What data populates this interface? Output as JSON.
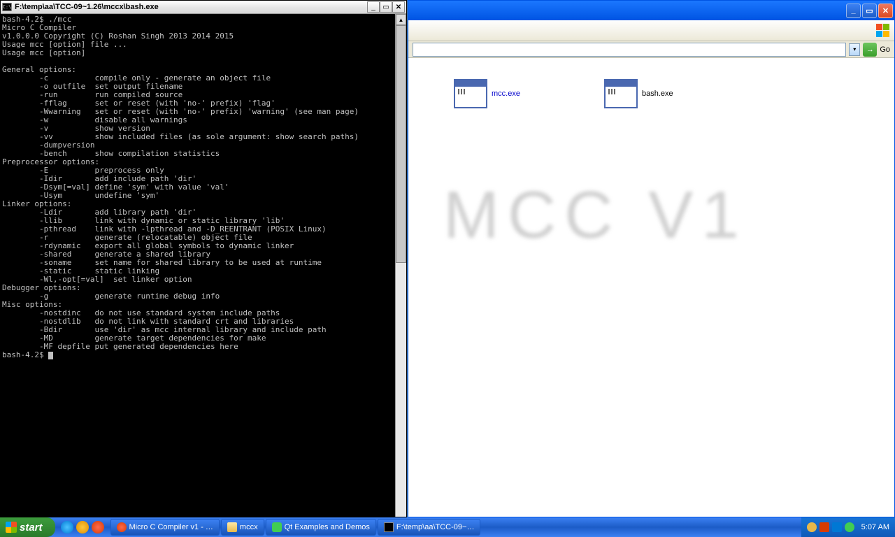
{
  "terminal": {
    "title": "F:\\temp\\aa\\TCC-09~1.26\\mccx\\bash.exe",
    "lines": [
      "bash-4.2$ ./mcc",
      "Micro C Compiler",
      "v1.0.0.0 Copyright (C) Roshan Singh 2013 2014 2015",
      "Usage mcc [option] file ...",
      "Usage mcc [option]",
      "",
      "General options:",
      "        -c          compile only - generate an object file",
      "        -o outfile  set output filename",
      "        -run        run compiled source",
      "        -fflag      set or reset (with 'no-' prefix) 'flag'",
      "        -Wwarning   set or reset (with 'no-' prefix) 'warning' (see man page)",
      "        -w          disable all warnings",
      "        -v          show version",
      "        -vv         show included files (as sole argument: show search paths)",
      "        -dumpversion",
      "        -bench      show compilation statistics",
      "Preprocessor options:",
      "        -E          preprocess only",
      "        -Idir       add include path 'dir'",
      "        -Dsym[=val] define 'sym' with value 'val'",
      "        -Usym       undefine 'sym'",
      "Linker options:",
      "        -Ldir       add library path 'dir'",
      "        -llib       link with dynamic or static library 'lib'",
      "        -pthread    link with -lpthread and -D_REENTRANT (POSIX Linux)",
      "        -r          generate (relocatable) object file",
      "        -rdynamic   export all global symbols to dynamic linker",
      "        -shared     generate a shared library",
      "        -soname     set name for shared library to be used at runtime",
      "        -static     static linking",
      "        -Wl,-opt[=val]  set linker option",
      "Debugger options:",
      "        -g          generate runtime debug info",
      "Misc options:",
      "        -nostdinc   do not use standard system include paths",
      "        -nostdlib   do not link with standard crt and libraries",
      "        -Bdir       use 'dir' as mcc internal library and include path",
      "        -MD         generate target dependencies for make",
      "        -MF depfile put generated dependencies here",
      "bash-4.2$ "
    ]
  },
  "explorer": {
    "go_label": "Go",
    "files": [
      {
        "name": "mcc.exe",
        "selected": true
      },
      {
        "name": "bash.exe",
        "selected": false
      }
    ],
    "watermark": "MCC V1"
  },
  "taskbar": {
    "start": "start",
    "tasks": [
      "Micro C Compiler v1 - …",
      "mccx",
      "Qt Examples and Demos",
      "F:\\temp\\aa\\TCC-09~…"
    ],
    "clock": "5:07 AM"
  }
}
